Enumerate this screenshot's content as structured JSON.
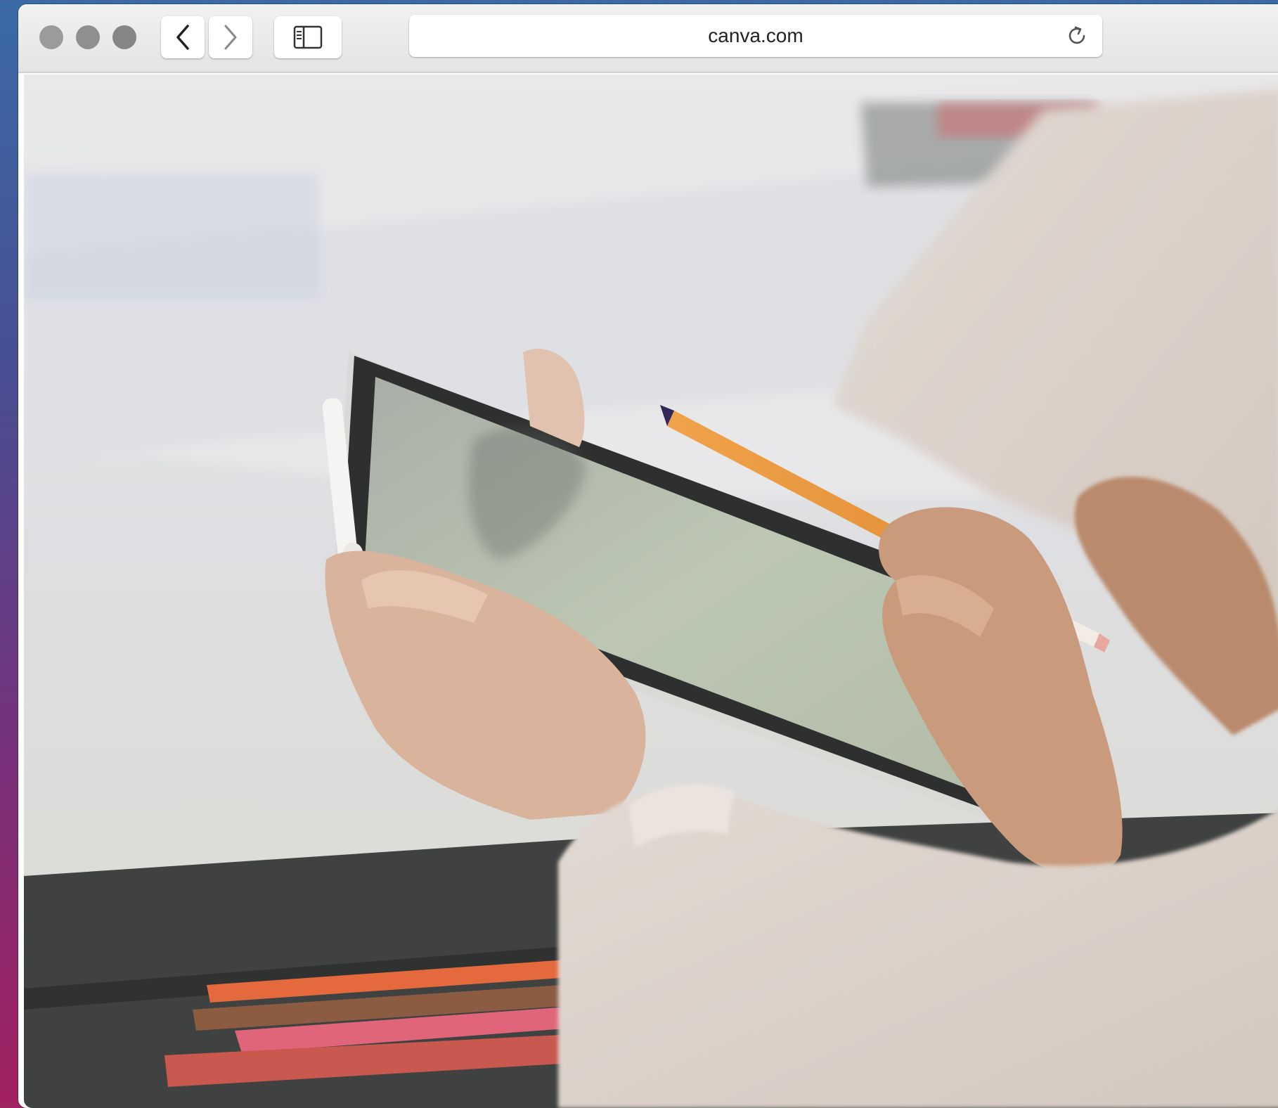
{
  "browser": {
    "address_bar": {
      "url": "canva.com"
    },
    "window_controls": [
      "close",
      "minimize",
      "zoom"
    ],
    "icons": {
      "back": "chevron-left-icon",
      "forward": "chevron-right-icon",
      "sidebar": "sidebar-icon",
      "reload": "reload-icon"
    }
  },
  "content": {
    "image_subject": "photo",
    "colors": {
      "pencil": "#e8973a",
      "pencil_red": "#d9553a",
      "pink_pencil": "#e0657a",
      "tablet_screen": "#b7c3ad",
      "desk_dark": "#3b3d3c"
    }
  }
}
